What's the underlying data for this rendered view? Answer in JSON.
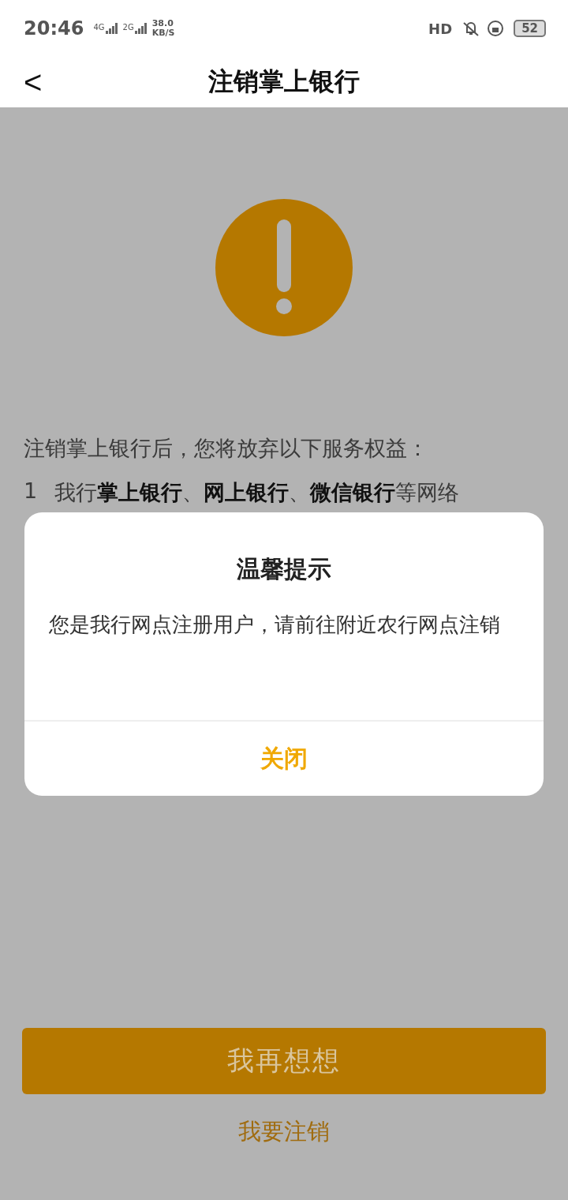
{
  "status_bar": {
    "time": "20:46",
    "networks": [
      {
        "label": "4G"
      },
      {
        "label": "2G"
      }
    ],
    "speed": "38.0",
    "speed_unit": "KB/S",
    "hd": "HD",
    "battery": "52"
  },
  "header": {
    "back": "<",
    "title": "注销掌上银行"
  },
  "content": {
    "intro": "注销掌上银行后，您将放弃以下服务权益：",
    "items": [
      {
        "number": "1",
        "text": "我行**掌上银行**、**网上银行**、**微信银行**等网络"
      }
    ]
  },
  "dialog": {
    "title": "温馨提示",
    "message": "您是我行网点注册用户，请前往附近农行网点注销",
    "close": "关闭"
  },
  "primary_button": "我再想想",
  "secondary_link": "我要注销"
}
